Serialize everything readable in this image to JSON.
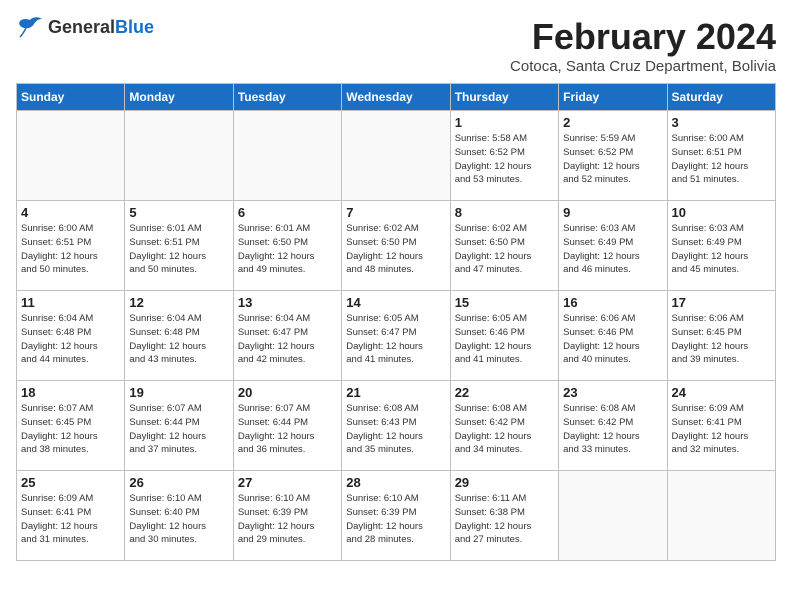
{
  "header": {
    "logo_general": "General",
    "logo_blue": "Blue",
    "month_title": "February 2024",
    "location": "Cotoca, Santa Cruz Department, Bolivia"
  },
  "days_of_week": [
    "Sunday",
    "Monday",
    "Tuesday",
    "Wednesday",
    "Thursday",
    "Friday",
    "Saturday"
  ],
  "weeks": [
    [
      {
        "day": "",
        "info": ""
      },
      {
        "day": "",
        "info": ""
      },
      {
        "day": "",
        "info": ""
      },
      {
        "day": "",
        "info": ""
      },
      {
        "day": "1",
        "info": "Sunrise: 5:58 AM\nSunset: 6:52 PM\nDaylight: 12 hours\nand 53 minutes."
      },
      {
        "day": "2",
        "info": "Sunrise: 5:59 AM\nSunset: 6:52 PM\nDaylight: 12 hours\nand 52 minutes."
      },
      {
        "day": "3",
        "info": "Sunrise: 6:00 AM\nSunset: 6:51 PM\nDaylight: 12 hours\nand 51 minutes."
      }
    ],
    [
      {
        "day": "4",
        "info": "Sunrise: 6:00 AM\nSunset: 6:51 PM\nDaylight: 12 hours\nand 50 minutes."
      },
      {
        "day": "5",
        "info": "Sunrise: 6:01 AM\nSunset: 6:51 PM\nDaylight: 12 hours\nand 50 minutes."
      },
      {
        "day": "6",
        "info": "Sunrise: 6:01 AM\nSunset: 6:50 PM\nDaylight: 12 hours\nand 49 minutes."
      },
      {
        "day": "7",
        "info": "Sunrise: 6:02 AM\nSunset: 6:50 PM\nDaylight: 12 hours\nand 48 minutes."
      },
      {
        "day": "8",
        "info": "Sunrise: 6:02 AM\nSunset: 6:50 PM\nDaylight: 12 hours\nand 47 minutes."
      },
      {
        "day": "9",
        "info": "Sunrise: 6:03 AM\nSunset: 6:49 PM\nDaylight: 12 hours\nand 46 minutes."
      },
      {
        "day": "10",
        "info": "Sunrise: 6:03 AM\nSunset: 6:49 PM\nDaylight: 12 hours\nand 45 minutes."
      }
    ],
    [
      {
        "day": "11",
        "info": "Sunrise: 6:04 AM\nSunset: 6:48 PM\nDaylight: 12 hours\nand 44 minutes."
      },
      {
        "day": "12",
        "info": "Sunrise: 6:04 AM\nSunset: 6:48 PM\nDaylight: 12 hours\nand 43 minutes."
      },
      {
        "day": "13",
        "info": "Sunrise: 6:04 AM\nSunset: 6:47 PM\nDaylight: 12 hours\nand 42 minutes."
      },
      {
        "day": "14",
        "info": "Sunrise: 6:05 AM\nSunset: 6:47 PM\nDaylight: 12 hours\nand 41 minutes."
      },
      {
        "day": "15",
        "info": "Sunrise: 6:05 AM\nSunset: 6:46 PM\nDaylight: 12 hours\nand 41 minutes."
      },
      {
        "day": "16",
        "info": "Sunrise: 6:06 AM\nSunset: 6:46 PM\nDaylight: 12 hours\nand 40 minutes."
      },
      {
        "day": "17",
        "info": "Sunrise: 6:06 AM\nSunset: 6:45 PM\nDaylight: 12 hours\nand 39 minutes."
      }
    ],
    [
      {
        "day": "18",
        "info": "Sunrise: 6:07 AM\nSunset: 6:45 PM\nDaylight: 12 hours\nand 38 minutes."
      },
      {
        "day": "19",
        "info": "Sunrise: 6:07 AM\nSunset: 6:44 PM\nDaylight: 12 hours\nand 37 minutes."
      },
      {
        "day": "20",
        "info": "Sunrise: 6:07 AM\nSunset: 6:44 PM\nDaylight: 12 hours\nand 36 minutes."
      },
      {
        "day": "21",
        "info": "Sunrise: 6:08 AM\nSunset: 6:43 PM\nDaylight: 12 hours\nand 35 minutes."
      },
      {
        "day": "22",
        "info": "Sunrise: 6:08 AM\nSunset: 6:42 PM\nDaylight: 12 hours\nand 34 minutes."
      },
      {
        "day": "23",
        "info": "Sunrise: 6:08 AM\nSunset: 6:42 PM\nDaylight: 12 hours\nand 33 minutes."
      },
      {
        "day": "24",
        "info": "Sunrise: 6:09 AM\nSunset: 6:41 PM\nDaylight: 12 hours\nand 32 minutes."
      }
    ],
    [
      {
        "day": "25",
        "info": "Sunrise: 6:09 AM\nSunset: 6:41 PM\nDaylight: 12 hours\nand 31 minutes."
      },
      {
        "day": "26",
        "info": "Sunrise: 6:10 AM\nSunset: 6:40 PM\nDaylight: 12 hours\nand 30 minutes."
      },
      {
        "day": "27",
        "info": "Sunrise: 6:10 AM\nSunset: 6:39 PM\nDaylight: 12 hours\nand 29 minutes."
      },
      {
        "day": "28",
        "info": "Sunrise: 6:10 AM\nSunset: 6:39 PM\nDaylight: 12 hours\nand 28 minutes."
      },
      {
        "day": "29",
        "info": "Sunrise: 6:11 AM\nSunset: 6:38 PM\nDaylight: 12 hours\nand 27 minutes."
      },
      {
        "day": "",
        "info": ""
      },
      {
        "day": "",
        "info": ""
      }
    ]
  ]
}
